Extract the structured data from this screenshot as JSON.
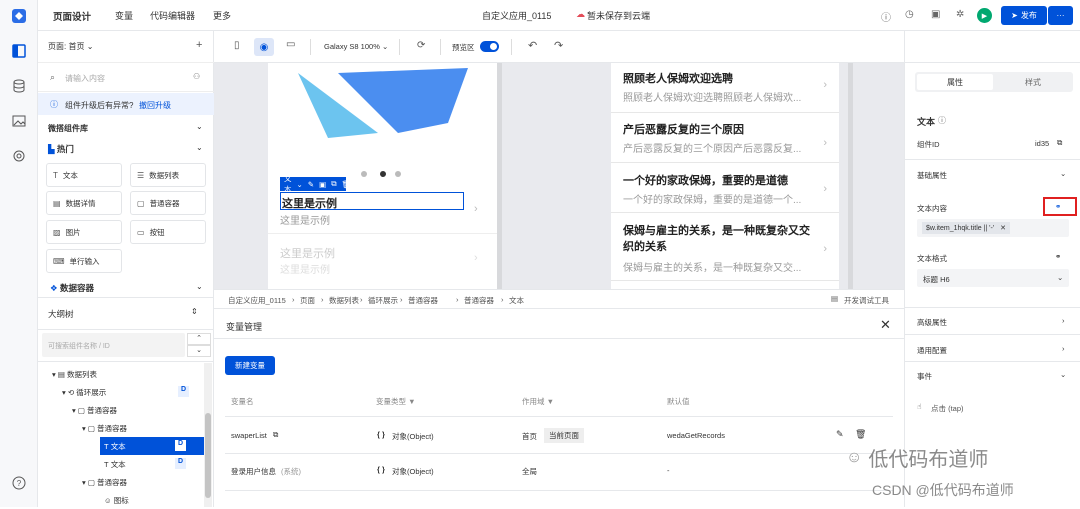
{
  "topbar": {
    "title": "页面设计",
    "nav": [
      "变量",
      "代码编辑器",
      "更多"
    ],
    "app_name": "自定义应用_0115",
    "save_status": "暂未保存到云端",
    "publish": "发布",
    "more": "···"
  },
  "left": {
    "page_select": "页面: 首页",
    "search_placeholder": "请输入内容",
    "upgrade_notice": "组件升级后有异常?",
    "upgrade_link": "撤回升级",
    "library_title": "微搭组件库",
    "hot_title": "热门",
    "components": [
      "文本",
      "数据列表",
      "数据详情",
      "普通容器",
      "图片",
      "按钮",
      "单行输入"
    ],
    "data_container": "数据容器",
    "outline_title": "大纲树",
    "outline_search": "可搜索组件名称 / ID",
    "tree": [
      "数据列表",
      "循环展示",
      "普通容器",
      "普通容器",
      "文本",
      "文本",
      "普通容器",
      "图标"
    ],
    "badge": "D"
  },
  "canvas_toolbar": {
    "device": "Galaxy S8 100%",
    "preview": "预览区"
  },
  "canvas": {
    "selected_label": "文本",
    "sample_title": "这里是示例",
    "sample_sub": "这里是示例",
    "faded_title": "这里是示例",
    "faded_sub": "这里是示例",
    "list": [
      {
        "title": "照顾老人保姆欢迎选聘",
        "sub": "照顾老人保姆欢迎选聘照顾老人保姆欢..."
      },
      {
        "title": "产后恶露反复的三个原因",
        "sub": "产后恶露反复的三个原因产后恶露反复..."
      },
      {
        "title": "一个好的家政保姆，重要的是道德",
        "sub": "一个好的家政保姆，重要的是道德一个..."
      },
      {
        "title": "保姆与雇主的关系，是一种既复杂又交织的关系",
        "sub": "保姆与雇主的关系，是一种既复杂又交..."
      }
    ]
  },
  "breadcrumb": {
    "items": [
      "自定义应用_0115",
      "页面",
      "数据列表",
      "循环展示",
      "普通容器",
      "普通容器",
      "文本"
    ],
    "debug": "开发调试工具"
  },
  "variables": {
    "title": "变量管理",
    "new_button": "新建变量",
    "headers": [
      "变量名",
      "变量类型",
      "作用域",
      "默认值"
    ],
    "rows": [
      {
        "name": "swaperList",
        "type": "对象(Object)",
        "scope": "首页",
        "scope_tag": "当前页面",
        "default": "wedaGetRecords"
      },
      {
        "name": "登录用户信息",
        "name_tag": "(系统)",
        "type": "对象(Object)",
        "scope": "全局",
        "default": "-"
      }
    ]
  },
  "right": {
    "tabs": [
      "属性",
      "样式"
    ],
    "comp_name": "文本",
    "comp_id_label": "组件ID",
    "comp_id": "id35",
    "basic": "基础属性",
    "content_label": "文本内容",
    "content_value": "$w.item_1hqk.title || '-'",
    "format_label": "文本格式",
    "format_value": "标题 H6",
    "advanced": "高级属性",
    "common": "通用配置",
    "events": "事件",
    "event_item": "点击 (tap)"
  },
  "watermark": {
    "line1": "低代码布道师",
    "line2": "CSDN @低代码布道师"
  },
  "colors": {
    "primary": "#0052d9",
    "highlight_box": "#e02020",
    "tree_selected": "#0052d9",
    "play": "#00a870"
  }
}
